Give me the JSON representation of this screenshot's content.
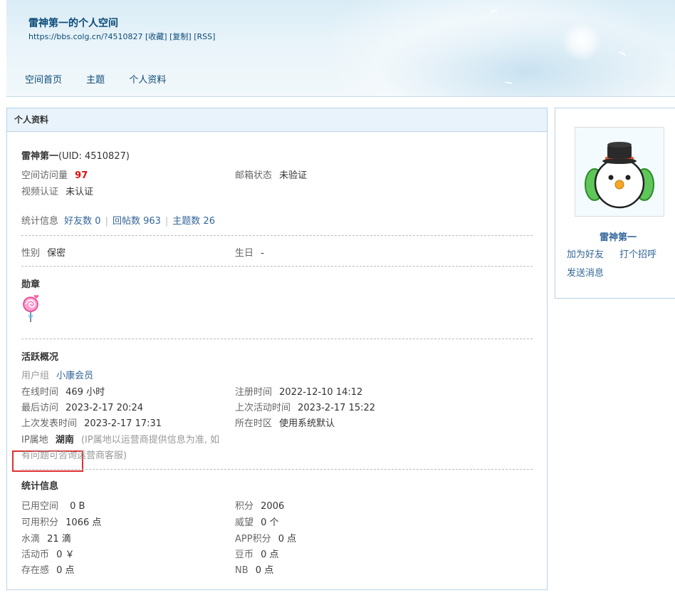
{
  "header": {
    "title": "雷神第一的个人空间",
    "url": "https://bbs.colg.cn/?4510827",
    "url_links": [
      "[收藏]",
      "[复制]",
      "[RSS]"
    ],
    "nav": [
      "空间首页",
      "主题",
      "个人资料"
    ]
  },
  "panel": {
    "title": "个人资料",
    "username": "雷神第一",
    "uid": "(UID: 4510827)",
    "visits_label": "空间访问量",
    "visits_value": "97",
    "email_label": "邮箱状态",
    "email_value": "未验证",
    "video_label": "视频认证",
    "video_value": "未认证",
    "stats_label": "统计信息",
    "friends": "好友数 0",
    "replies": "回帖数 963",
    "topics": "主题数 26",
    "gender_label": "性别",
    "gender_value": "保密",
    "birthday_label": "生日",
    "birthday_value": "-",
    "medals_title": "勋章",
    "activity_title": "活跃概况",
    "usergroup_label": "用户组",
    "usergroup_value": "小康会员",
    "online_label": "在线时间",
    "online_value": "469 小时",
    "register_label": "注册时间",
    "register_value": "2022-12-10 14:12",
    "last_visit_label": "最后访问",
    "last_visit_value": "2023-2-17 20:24",
    "last_active_label": "上次活动时间",
    "last_active_value": "2023-2-17 15:22",
    "last_post_label": "上次发表时间",
    "last_post_value": "2023-2-17 17:31",
    "timezone_label": "所在时区",
    "timezone_value": "使用系统默认",
    "ip_label": "IP属地",
    "ip_value": "湖南",
    "ip_note_1": "(IP属地以运营商提供信息为准, 如",
    "ip_note_2": "有问题可咨询运营商客服)",
    "stats_title": "统计信息",
    "used_space_label": "已用空间",
    "used_space_value": "0 B",
    "points_label": "积分",
    "points_value": "2006",
    "usable_points_label": "可用积分",
    "usable_points_value": "1066 点",
    "prestige_label": "威望",
    "prestige_value": "0 个",
    "water_label": "水滴",
    "water_value": "21 滴",
    "app_points_label": "APP积分",
    "app_points_value": "0 点",
    "coins_label": "活动币",
    "coins_value": "0 ￥",
    "beans_label": "豆币",
    "beans_value": "0 点",
    "presence_label": "存在感",
    "presence_value": "0 点",
    "nb_label": "NB",
    "nb_value": "0 点"
  },
  "side": {
    "name": "雷神第一",
    "add_friend": "加为好友",
    "greet": "打个招呼",
    "message": "发送消息"
  },
  "colors": {
    "link": "#336699",
    "highlight_red": "#e01010",
    "ip_box_border": "#e03030",
    "panel_header_bg": "#e8f3fb"
  }
}
